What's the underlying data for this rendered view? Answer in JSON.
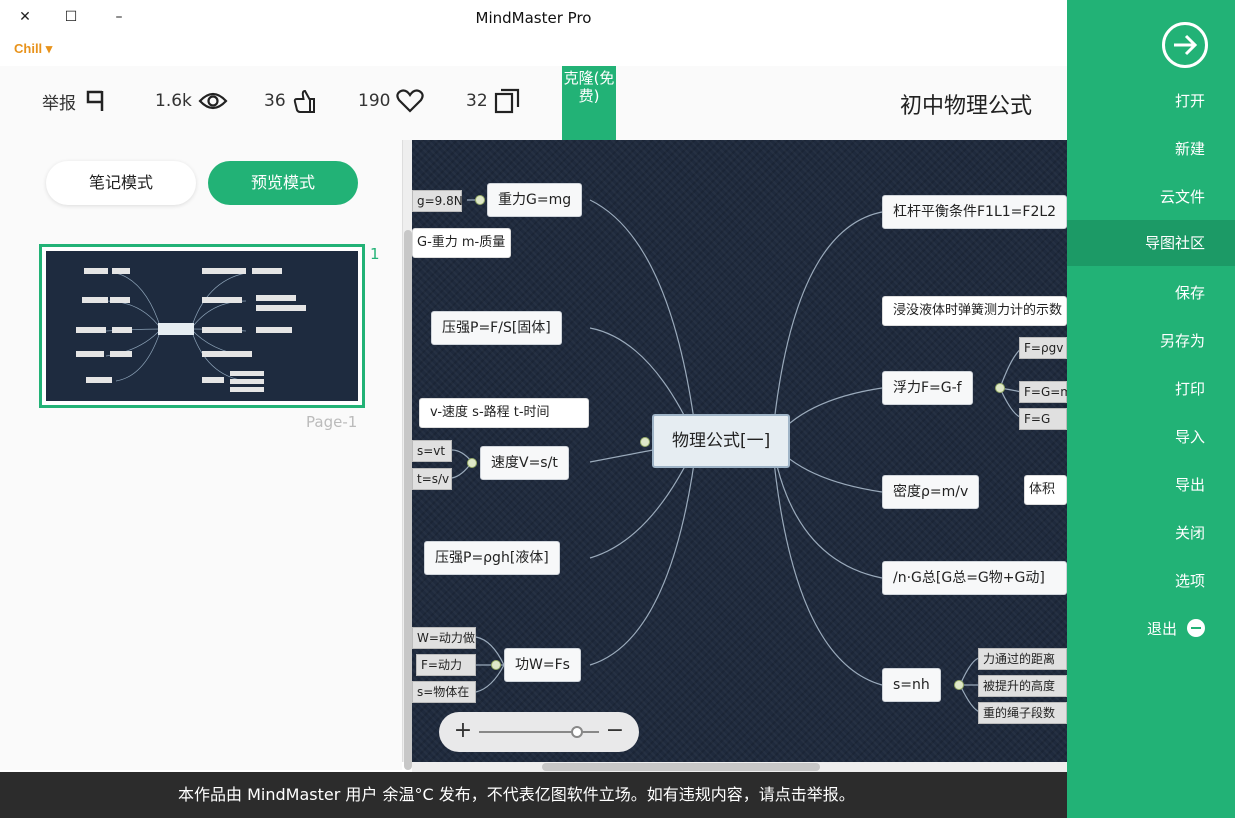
{
  "window": {
    "title": "MindMaster Pro",
    "brand": "Chill"
  },
  "toolbar": {
    "report_label": "举报",
    "views": "1.6k",
    "likes": "36",
    "favorites": "190",
    "copies": "32",
    "clone_badge": "克隆(免费)",
    "doc_title": "初中物理公式"
  },
  "left_panel": {
    "preview_mode": "预览模式",
    "notes_mode": "笔记模式",
    "page_number": "1",
    "page_label": "Page-1"
  },
  "mindmap": {
    "central": "物理公式[一]",
    "left_nodes": {
      "gravity": "重力G=mg",
      "gravity_g": "g=9.8N",
      "gravity_note": "G-重力 m-质量",
      "pressure_solid": "压强P=F/S[固体]",
      "speed_note": "v-速度 s-路程 t-时间",
      "speed": "速度V=s/t",
      "speed_s": "s=vt",
      "speed_t": "t=s/v",
      "pressure_liquid": "压强P=ρgh[液体]",
      "work": "功W=Fs",
      "work_w": "W=动力做",
      "work_f": "F=动力",
      "work_s": "s=物体在"
    },
    "right_nodes": {
      "lever": "杠杆平衡条件F1L1=F2L2",
      "buoyancy_note": "浸没液体时弹簧测力计的示数",
      "buoyancy": "浮力F=G-f",
      "buoyancy_a": "F=ρgv",
      "buoyancy_b": "F=G=mg",
      "buoyancy_c": "F=G",
      "density": "密度ρ=m/v",
      "density_note": "体积",
      "total": "/n·G总[G总=G物+G动]",
      "pulley": "s=nh",
      "pulley_a": "力通过的距离",
      "pulley_b": "被提升的高度",
      "pulley_c": "重的绳子段数"
    }
  },
  "side_menu": {
    "items": [
      "打开",
      "新建",
      "云文件",
      "导图社区",
      "保存",
      "另存为",
      "打印",
      "导入",
      "导出",
      "关闭",
      "选项",
      "退出"
    ],
    "active": "导图社区"
  },
  "notice": "本作品由 MindMaster 用户 余温°C 发布，不代表亿图软件立场。如有违规内容，请点击举报。",
  "colors": {
    "accent": "#22b276",
    "canvas_bg": "#1f2a3d",
    "notice_bg": "#2c2c2c"
  }
}
